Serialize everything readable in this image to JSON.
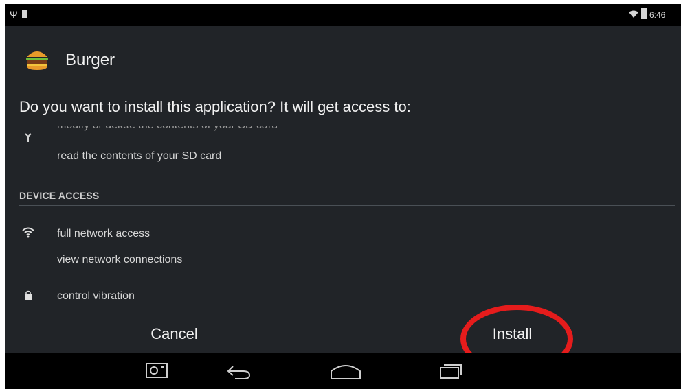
{
  "status_bar": {
    "time": "6:46"
  },
  "app": {
    "name": "Burger"
  },
  "prompt": "Do you want to install this application? It will get access to:",
  "permissions": {
    "storage_clipped": "modify or delete the contents of your SD card",
    "storage_read": "read the contents of your SD card",
    "device_access_header": "DEVICE ACCESS",
    "network_full": "full network access",
    "network_view": "view network connections",
    "vibration": "control vibration"
  },
  "buttons": {
    "cancel": "Cancel",
    "install": "Install"
  },
  "colors": {
    "background": "#212428",
    "highlight": "#e51c1c",
    "text": "#f1f1f1"
  },
  "icons": [
    "usb-icon",
    "sd-card-icon",
    "wifi-signal-icon",
    "battery-icon",
    "burger-icon",
    "sd-storage-icon",
    "network-icon",
    "lock-icon",
    "screenshot-icon",
    "back-icon",
    "home-icon",
    "recents-icon"
  ]
}
